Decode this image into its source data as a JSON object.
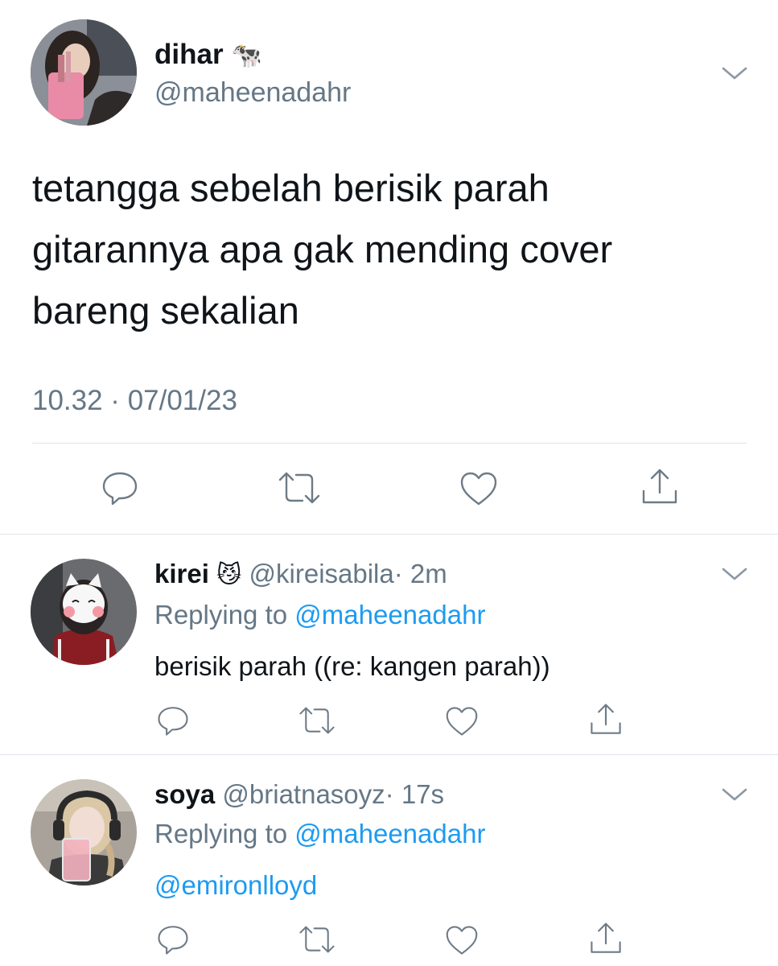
{
  "main_tweet": {
    "display_name": "dihar",
    "emoji": "🐄",
    "handle": "@maheenadahr",
    "text_lines": [
      "tetangga sebelah berisik parah",
      "gitarannya apa gak mending cover",
      "bareng sekalian"
    ],
    "timestamp": "10.32 · 07/01/23"
  },
  "replies": [
    {
      "display_name": "kirei",
      "emoji": "😼",
      "handle": "@kireisabila",
      "time": "· 2m",
      "replying_prefix": "Replying to",
      "replying_handle": "@maheenadahr",
      "text": "berisik parah ((re: kangen parah))"
    },
    {
      "display_name": "soya",
      "emoji": "",
      "handle": "@briatnasoyz",
      "time": "· 17s",
      "replying_prefix": "Replying to",
      "replying_handle": "@maheenadahr",
      "text": "@emironlloyd"
    }
  ],
  "colors": {
    "text": "#0f1419",
    "secondary": "#657786",
    "link": "#1d9bf0",
    "divider": "#dfe3e8"
  },
  "icons": [
    "chevron-down-icon",
    "reply-icon",
    "retweet-icon",
    "like-icon",
    "share-icon"
  ]
}
